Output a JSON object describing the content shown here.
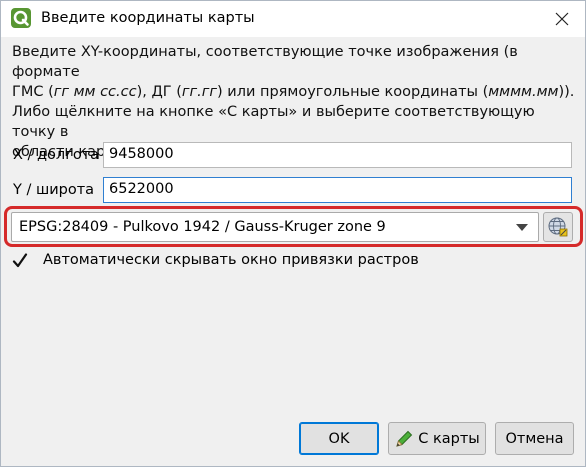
{
  "window": {
    "title": "Введите координаты карты",
    "app_icon": "qgis-icon",
    "close_icon": "close-icon"
  },
  "description": {
    "line1": "Введите XY-координаты, соответствующие точке изображения (в формате",
    "line2_pre": "ГМС (",
    "line2_dms": "гг мм сс.сс",
    "line2_mid": "), ДГ (",
    "line2_dd": "гг.гг",
    "line2_post": ") или прямоугольные координаты (",
    "line2_proj": "мммм.мм",
    "line2_end": ")).",
    "line3": "Либо щёлкните на кнопке «С карты» и выберите соответствующую точку в",
    "line4": "области карты QGIS."
  },
  "fields": {
    "x_label": "X / долгота",
    "x_value": "9458000",
    "y_label": "Y / широта",
    "y_value": "6522000"
  },
  "crs": {
    "selected": "EPSG:28409 - Pulkovo 1942 / Gauss-Kruger zone 9",
    "button_icon": "globe-crs-icon",
    "highlight_color": "#d52a2a"
  },
  "options": {
    "auto_hide_label": "Автоматически скрывать окно привязки растров",
    "auto_hide_checked": true
  },
  "buttons": {
    "ok": "OK",
    "from_map": "С карты",
    "cancel": "Отмена"
  }
}
